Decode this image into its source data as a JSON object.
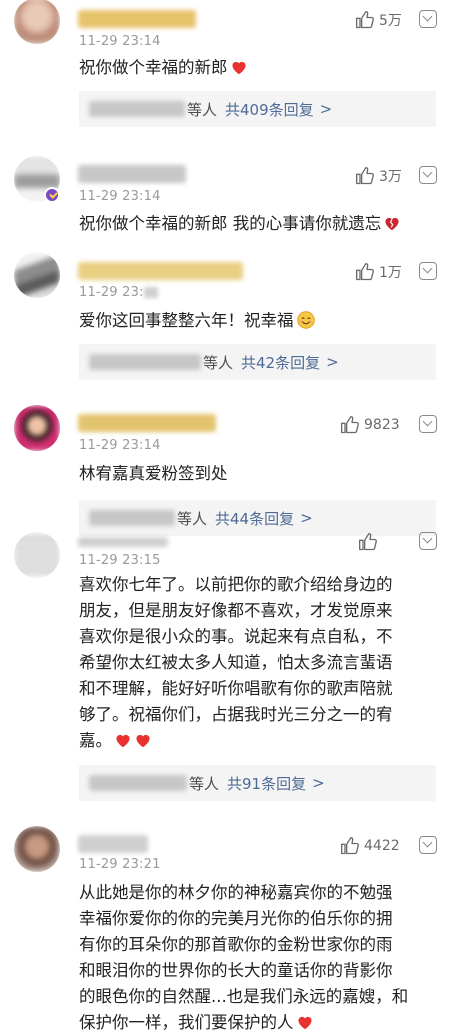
{
  "comments": [
    {
      "time": "11-29 23:14",
      "likes": "5万",
      "lines": [
        "祝你做个幸福的新郎"
      ],
      "reply": {
        "suffix": "等人",
        "count": "共409条回复",
        "arrow": ">"
      }
    },
    {
      "time": "11-29 23:14",
      "likes": "3万",
      "lines": [
        "祝你做个幸福的新郎 我的心事请你就遗忘"
      ]
    },
    {
      "time": "11-29 23:",
      "likes": "1万",
      "lines": [
        "爱你这回事整整六年！祝幸福"
      ],
      "reply": {
        "suffix": "等人",
        "count": "共42条回复",
        "arrow": ">"
      }
    },
    {
      "time": "11-29 23:14",
      "likes": "9823",
      "lines": [
        "林宥嘉真爱粉签到处"
      ],
      "reply": {
        "suffix": "等人",
        "count": "共44条回复",
        "arrow": ">"
      }
    },
    {
      "time": "11-29 23:15",
      "likes": "",
      "lines": [
        "喜欢你七年了。以前把你的歌介绍给身边的",
        "朋友，但是朋友好像都不喜欢，才发觉原来",
        "喜欢你是很小众的事。说起来有点自私，不",
        "希望你太红被太多人知道，怕太多流言蜚语",
        "和不理解，能好好听你唱歌有你的歌声陪就",
        "够了。祝福你们，占据我时光三分之一的宥",
        "嘉。"
      ],
      "reply": {
        "suffix": "等人",
        "count": "共91条回复",
        "arrow": ">"
      }
    },
    {
      "time": "11-29 23:21",
      "likes": "4422",
      "lines": [
        "从此她是你的林夕你的神秘嘉宾你的不勉强",
        "幸福你爱你的你的完美月光你的伯乐你的拥",
        "有你的耳朵你的那首歌你的金粉世家你的雨",
        "和眼泪你的世界你的长大的童话你的背影你",
        "的眼色你的自然醒...也是我们永远的嘉嫂，和",
        "保护你一样，我们要保护的人"
      ]
    }
  ],
  "colors": {
    "heart_red": "#e8322f",
    "broken_heart": "#c9262f",
    "link_blue": "#4e6a96",
    "meta_gray": "#9a9a9a",
    "reply_bg": "#f4f4f4"
  },
  "icons": {
    "like": "thumbs-up-icon",
    "more": "chevron-down-box-icon",
    "verified": "verified-badge-icon"
  }
}
